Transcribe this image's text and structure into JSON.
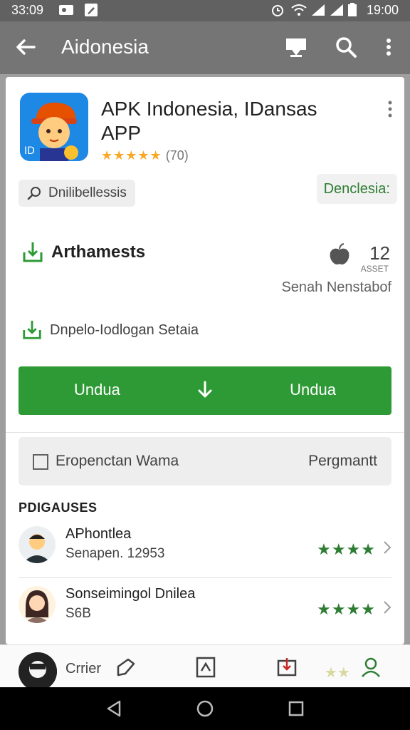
{
  "status_bar": {
    "time_left": "33:09",
    "time_right": "19:00"
  },
  "app_bar": {
    "title": "Aidonesia"
  },
  "app": {
    "name": "APK Indonesia, IDansas APP",
    "stars": "★★★★★",
    "rating_count": "(70)",
    "chip_label": "Dnilibellessis",
    "green_chip_label": "Denclesia:"
  },
  "features": {
    "row1_label": "Arthamests",
    "row1_num": "12",
    "row1_sub": "ASSET",
    "row1_secondary": "Senah Nenstabof",
    "row2_label": "Dnpelo-Iodlogan Setaia"
  },
  "download_button": {
    "left_label": "Undua",
    "right_label": "Undua"
  },
  "toggle_row": {
    "label": "Eropenctan Wama",
    "right": "Pergmantt"
  },
  "section_title": "PDIGAUSES",
  "reviews": [
    {
      "name": "APhontlea",
      "sub": "Senapen. 12953",
      "stars": "★★★★"
    },
    {
      "name": "Sonseimingol Dnilea",
      "sub": "S6B",
      "stars": "★★★★"
    }
  ],
  "bottom_tabs": {
    "label": "Crrier",
    "stars": "★★"
  },
  "colors": {
    "accent_green": "#2e9a35",
    "star_yellow": "#f9a825",
    "app_bar": "#757575"
  }
}
